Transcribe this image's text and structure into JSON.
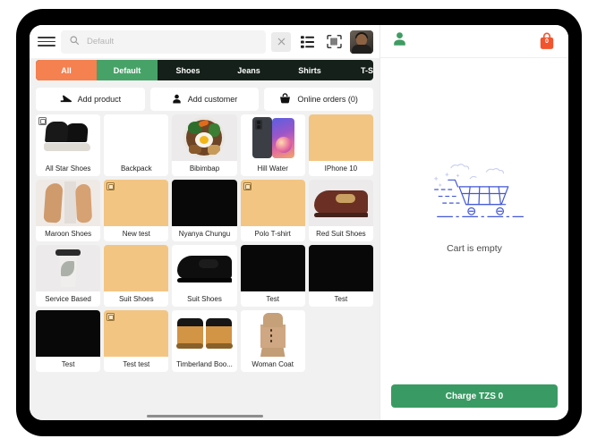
{
  "app": {
    "currency": "TZS"
  },
  "topbar": {
    "menu_icon": "hamburger-menu-icon",
    "search_icon": "search-icon",
    "search_value": "Default",
    "search_placeholder": "Default",
    "clear_icon": "close-icon",
    "list_icon": "list-view-icon",
    "barcode_icon": "barcode-scanner-icon",
    "avatar_icon": "user-avatar-photo"
  },
  "tabs": [
    {
      "label": "All",
      "state": "active-all"
    },
    {
      "label": "Default",
      "state": "active-default"
    },
    {
      "label": "Shoes",
      "state": "plain"
    },
    {
      "label": "Jeans",
      "state": "plain"
    },
    {
      "label": "Shirts",
      "state": "plain"
    },
    {
      "label": "T-Shi",
      "state": "plain"
    }
  ],
  "actions": [
    {
      "label": "Add product",
      "icon": "shoe-icon"
    },
    {
      "label": "Add customer",
      "icon": "person-icon"
    },
    {
      "label": "Online orders (0)",
      "icon": "basket-icon"
    }
  ],
  "products": [
    {
      "name": "All Star Shoes",
      "thumb": "sneaker",
      "badge": true
    },
    {
      "name": "Backpack",
      "thumb": "foodie",
      "badge": false
    },
    {
      "name": "Bibimbap",
      "thumb": "bibimbap",
      "badge": false
    },
    {
      "name": "Hill Water",
      "thumb": "phones",
      "badge": false
    },
    {
      "name": "IPhone 10",
      "thumb": "tan",
      "badge": false
    },
    {
      "name": "Maroon Shoes",
      "thumb": "legs",
      "badge": false
    },
    {
      "name": "New test",
      "thumb": "tan",
      "badge": true
    },
    {
      "name": "Nyanya Chungu",
      "thumb": "black",
      "badge": false
    },
    {
      "name": "Polo T-shirt",
      "thumb": "tan",
      "badge": true
    },
    {
      "name": "Red Suit Shoes",
      "thumb": "dressshoe",
      "badge": false
    },
    {
      "name": "Service Based",
      "thumb": "cup",
      "badge": false
    },
    {
      "name": "Suit Shoes",
      "thumb": "tan",
      "badge": false
    },
    {
      "name": "Suit Shoes",
      "thumb": "blackshoe",
      "badge": false
    },
    {
      "name": "Test",
      "thumb": "black",
      "badge": false
    },
    {
      "name": "Test",
      "thumb": "black",
      "badge": false
    },
    {
      "name": "Test",
      "thumb": "black",
      "badge": false
    },
    {
      "name": "Test test",
      "thumb": "tan",
      "badge": true
    },
    {
      "name": "Timberland Boo...",
      "thumb": "boots",
      "badge": false
    },
    {
      "name": "Woman Coat",
      "thumb": "coat",
      "badge": false
    }
  ],
  "cart": {
    "customer_icon": "person-icon",
    "bag_icon": "shopping-bag-icon",
    "item_count": "0",
    "empty_illustration": "empty-cart-illustration",
    "empty_text": "Cart is empty",
    "charge_label": "Charge TZS 0"
  },
  "colors": {
    "accent_orange": "#f58050",
    "accent_green": "#47a268",
    "tab_bar_dark": "#142019",
    "charge_green": "#399b63",
    "placeholder_tan": "#f3c583",
    "illustration_blue": "#3f51d6"
  }
}
